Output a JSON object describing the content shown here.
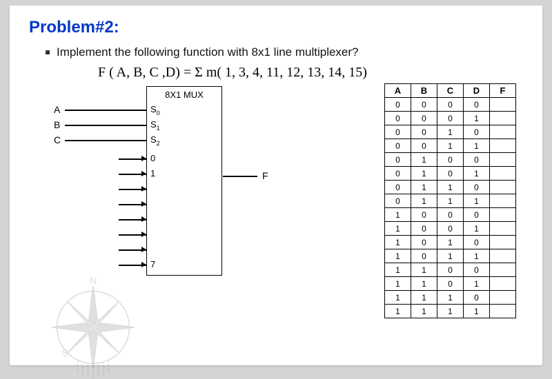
{
  "title": "Problem#2:",
  "statement": "Implement the following function with 8x1 line multiplexer?",
  "formula": "F ( A, B, C ,D)  =  Σ m( 1, 3, 4, 11, 12, 13, 14, 15)",
  "mux": {
    "header": "8X1 MUX",
    "select_inputs": [
      {
        "name": "A",
        "pin": "S",
        "sub": "0"
      },
      {
        "name": "B",
        "pin": "S",
        "sub": "1"
      },
      {
        "name": "C",
        "pin": "S",
        "sub": "2"
      }
    ],
    "data_first": "0",
    "data_second": "1",
    "data_last": "7",
    "output": "F"
  },
  "truth_table": {
    "headers": [
      "A",
      "B",
      "C",
      "D",
      "F"
    ],
    "rows": [
      [
        "0",
        "0",
        "0",
        "0",
        ""
      ],
      [
        "0",
        "0",
        "0",
        "1",
        ""
      ],
      [
        "0",
        "0",
        "1",
        "0",
        ""
      ],
      [
        "0",
        "0",
        "1",
        "1",
        ""
      ],
      [
        "0",
        "1",
        "0",
        "0",
        ""
      ],
      [
        "0",
        "1",
        "0",
        "1",
        ""
      ],
      [
        "0",
        "1",
        "1",
        "0",
        ""
      ],
      [
        "0",
        "1",
        "1",
        "1",
        ""
      ],
      [
        "1",
        "0",
        "0",
        "0",
        ""
      ],
      [
        "1",
        "0",
        "0",
        "1",
        ""
      ],
      [
        "1",
        "0",
        "1",
        "0",
        ""
      ],
      [
        "1",
        "0",
        "1",
        "1",
        ""
      ],
      [
        "1",
        "1",
        "0",
        "0",
        ""
      ],
      [
        "1",
        "1",
        "0",
        "1",
        ""
      ],
      [
        "1",
        "1",
        "1",
        "0",
        ""
      ],
      [
        "1",
        "1",
        "1",
        "1",
        ""
      ]
    ]
  }
}
